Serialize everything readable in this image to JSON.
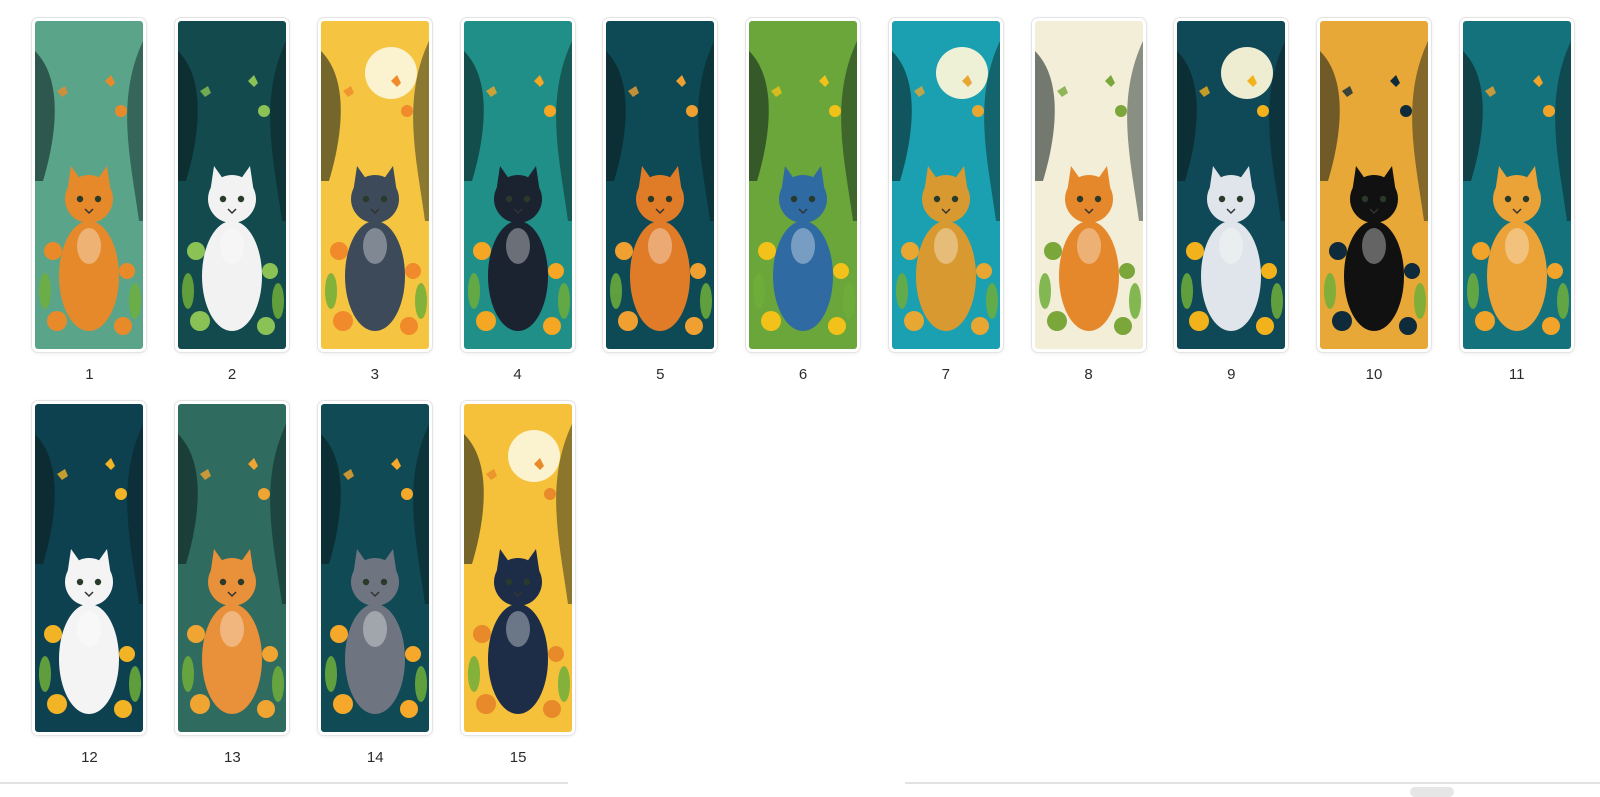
{
  "gallery": {
    "items": [
      {
        "label": "1",
        "bg": "#5aa58a",
        "accent": "#e98a2a",
        "cat": "#e5892a",
        "cat2": "#3f4752",
        "moon": false
      },
      {
        "label": "2",
        "bg": "#124a4e",
        "accent": "#8bc255",
        "cat": "#f2f2f2",
        "moon": false
      },
      {
        "label": "3",
        "bg": "#f5c542",
        "accent": "#f08a2a",
        "cat": "#3c4a5a",
        "moon": true
      },
      {
        "label": "4",
        "bg": "#1f8f88",
        "accent": "#f5a623",
        "cat": "#1b2230",
        "moon": false
      },
      {
        "label": "5",
        "bg": "#0e4a55",
        "accent": "#f0a030",
        "cat": "#e07c28",
        "moon": false
      },
      {
        "label": "6",
        "bg": "#6aa63a",
        "accent": "#f2c21a",
        "cat": "#2f6aa2",
        "moon": false
      },
      {
        "label": "7",
        "bg": "#1aa0b0",
        "accent": "#e8a632",
        "cat": "#d89a30",
        "moon": true
      },
      {
        "label": "8",
        "bg": "#f3eed8",
        "accent": "#7aa63a",
        "cat": "#e5882c",
        "moon": false
      },
      {
        "label": "9",
        "bg": "#0f4856",
        "accent": "#f2b21c",
        "cat": "#dfe5ea",
        "moon": true
      },
      {
        "label": "10",
        "bg": "#e8a838",
        "accent": "#0f2a3a",
        "cat": "#111111",
        "moon": false
      },
      {
        "label": "11",
        "bg": "#14727d",
        "accent": "#f2a32a",
        "cat": "#eba236",
        "moon": false
      },
      {
        "label": "12",
        "bg": "#0e4150",
        "accent": "#f2b425",
        "cat": "#f4f4f4",
        "moon": false
      },
      {
        "label": "13",
        "bg": "#2f6b5e",
        "accent": "#f0a431",
        "cat": "#e8903a",
        "moon": false
      },
      {
        "label": "14",
        "bg": "#0f4a55",
        "accent": "#f5a82a",
        "cat": "#6f7580",
        "moon": false
      },
      {
        "label": "15",
        "bg": "#f5c13a",
        "accent": "#e88a2a",
        "cat": "#1d2d48",
        "moon": true
      }
    ]
  }
}
